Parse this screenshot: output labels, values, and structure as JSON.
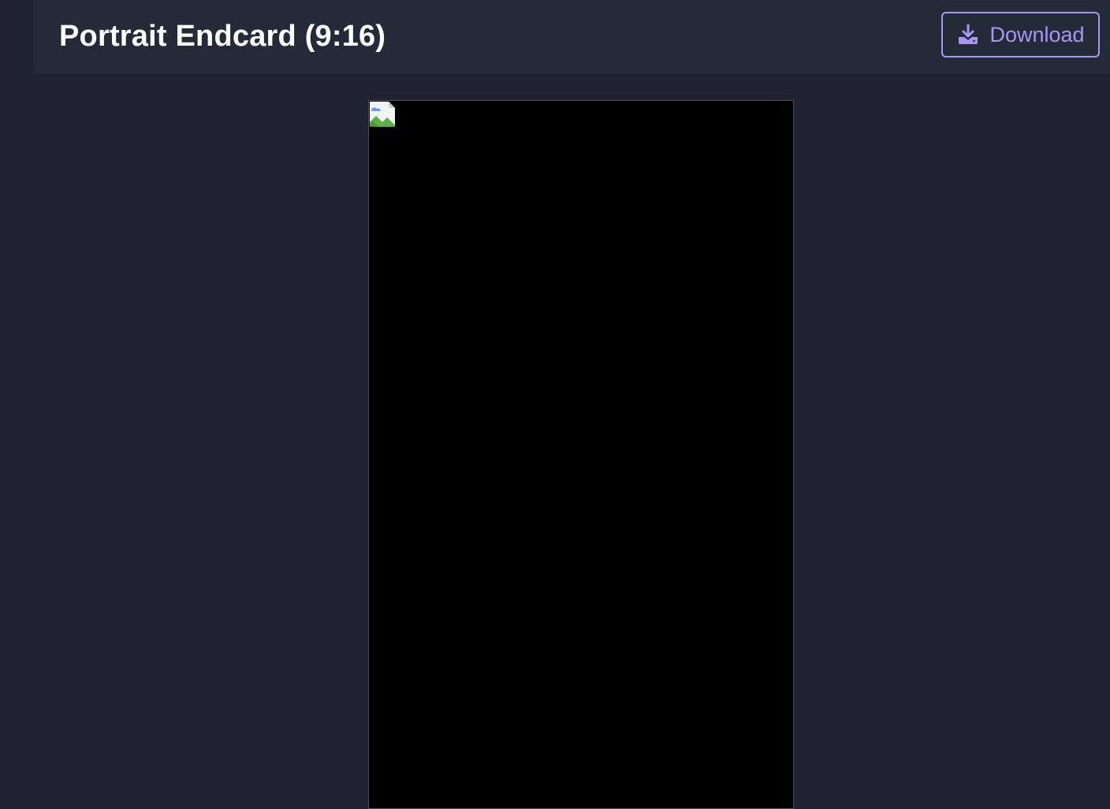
{
  "header": {
    "title": "Portrait Endcard (9:16)",
    "download_label": "Download"
  },
  "icons": {
    "download": "download-icon",
    "preview_placeholder": "broken-image-icon"
  },
  "colors": {
    "accent": "#a996f2",
    "header_bg": "#252a39",
    "page_bg": "#1e2231",
    "frame_bg": "#000000"
  }
}
